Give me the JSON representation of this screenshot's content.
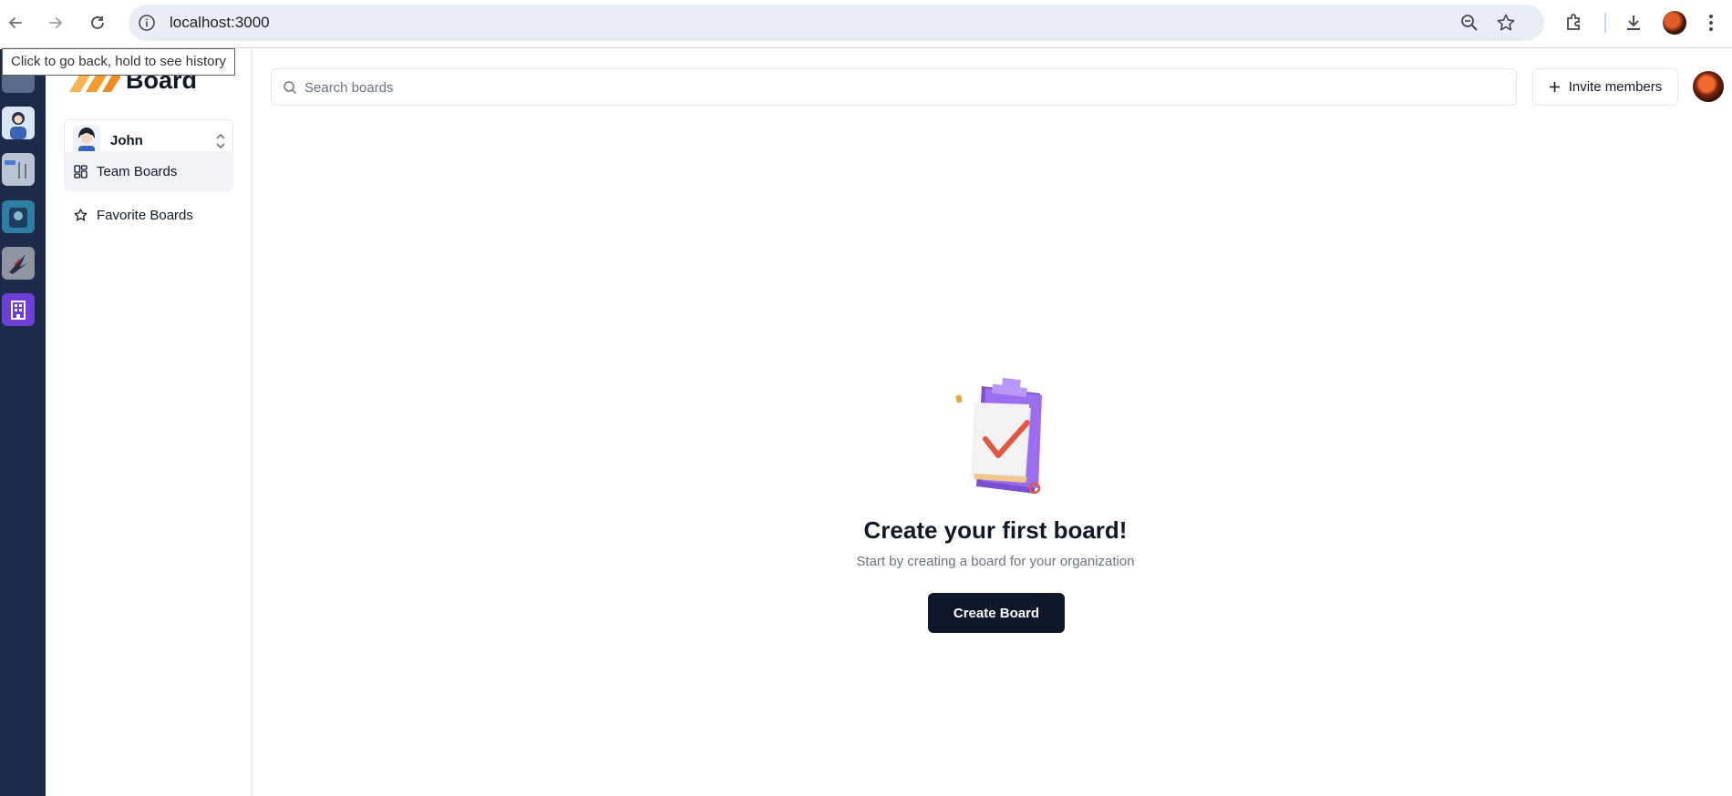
{
  "browser": {
    "url": "localhost:3000",
    "tooltip": "Click to go back, hold to see history",
    "icons": [
      "back-arrow-icon",
      "forward-arrow-icon",
      "reload-icon",
      "site-info-icon",
      "zoom-icon",
      "bookmark-star-icon",
      "extensions-icon",
      "download-icon",
      "profile-avatar",
      "more-menu-icon"
    ]
  },
  "rail": {
    "orgs": [
      "org-1",
      "org-2",
      "org-3",
      "org-4",
      "org-5",
      "org-6"
    ]
  },
  "sidebar": {
    "logo_text": "Board",
    "org_switcher": {
      "name": "John"
    },
    "items": [
      {
        "label": "Team Boards",
        "icon": "dashboard-grid-icon",
        "active": true
      },
      {
        "label": "Favorite Boards",
        "icon": "star-icon",
        "active": false
      }
    ]
  },
  "main": {
    "search": {
      "placeholder": "Search boards",
      "value": ""
    },
    "invite_label": "Invite members",
    "empty_state": {
      "title": "Create your first board!",
      "subtitle": "Start by creating a board for your organization",
      "button_label": "Create Board"
    }
  },
  "colors": {
    "rail_bg": "#1e2a4a",
    "primary_button": "#0f172a",
    "active_nav_bg": "#f1f3f6",
    "logo_accent": "#f5a33c",
    "illustration_purple": "#8b5cf6"
  }
}
